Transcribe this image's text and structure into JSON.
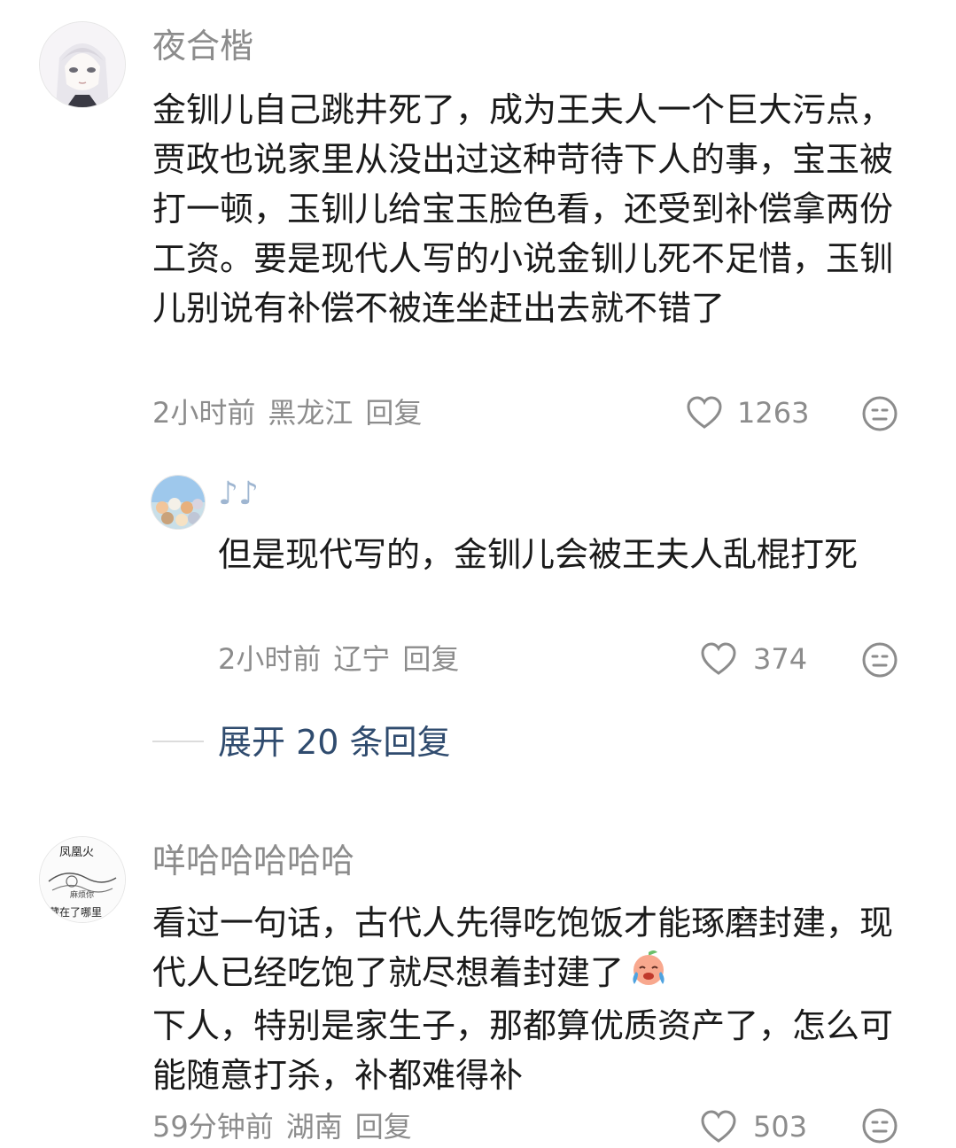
{
  "comments": [
    {
      "username": "夜合楷",
      "text": "金钏儿自己跳井死了，成为王夫人一个巨大污点，贾政也说家里从没出过这种苛待下人的事，宝玉被打一顿，玉钏儿给宝玉脸色看，还受到补偿拿两份工资。要是现代人写的小说金钏儿死不足惜，玉钏儿别说有补偿不被连坐赶出去就不错了",
      "time": "2小时前",
      "location": "黑龙江",
      "reply_label": "回复",
      "likes": "1263",
      "reply": {
        "username": "♪♪",
        "text": "但是现代写的，金钏儿会被王夫人乱棍打死",
        "time": "2小时前",
        "location": "辽宁",
        "reply_label": "回复",
        "likes": "374"
      },
      "expand_label": "展开 20 条回复"
    },
    {
      "username": "咩哈哈哈哈哈",
      "avatar_text_top": "凤凰火",
      "avatar_text_mid": "麻烦你",
      "avatar_text_bottom": "藏在了哪里",
      "text_part1": "看过一句话，古代人先得吃饱饭才能琢磨封建，现代人已经吃饱了就尽想着封建了",
      "text_part2": "下人，特别是家生子，那都算优质资产了，怎么可能随意打杀，补都难得补",
      "time": "59分钟前",
      "location": "湖南",
      "reply_label": "回复",
      "likes": "503"
    }
  ],
  "colors": {
    "meta": "#8c8c8c",
    "expand": "#2f4b6e",
    "text": "#1a1a1a"
  },
  "icons": [
    "heart-icon",
    "face-icon",
    "crying-emoji"
  ]
}
